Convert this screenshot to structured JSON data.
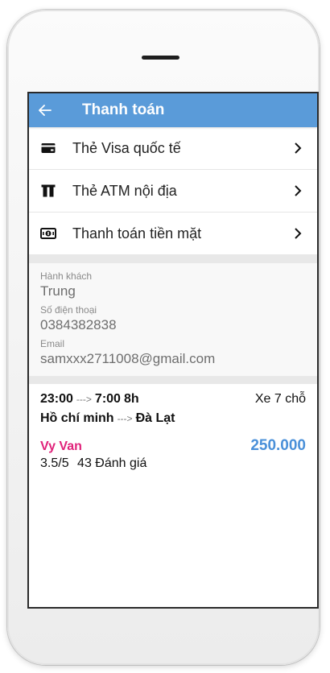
{
  "appbar": {
    "title": "Thanh toán",
    "back_icon": "arrow-left-icon",
    "color": "#5a9bd9"
  },
  "payment_methods": [
    {
      "label": "Thẻ Visa quốc tế",
      "icon": "credit-card-icon"
    },
    {
      "label": "Thẻ ATM nội địa",
      "icon": "atm-card-icon"
    },
    {
      "label": "Thanh toán tiền mặt",
      "icon": "cash-icon"
    }
  ],
  "passenger": {
    "name_label": "Hành khách",
    "name": "Trung",
    "phone_label": "Số điện thoại",
    "phone": "0384382838",
    "email_label": "Email",
    "email": "samxxx2711008@gmail.com"
  },
  "trip": {
    "depart": "23:00",
    "arrow": "--->",
    "arrive": "7:00",
    "duration": "8h",
    "vehicle": "Xe 7 chỗ",
    "from": "Hồ chí minh",
    "to": "Đà Lạt",
    "driver": "Vy Van",
    "price": "250.000",
    "rating": "3.5/5",
    "reviews": "43 Đánh giá",
    "driver_color": "#e0227a",
    "price_color": "#4a90d9"
  }
}
